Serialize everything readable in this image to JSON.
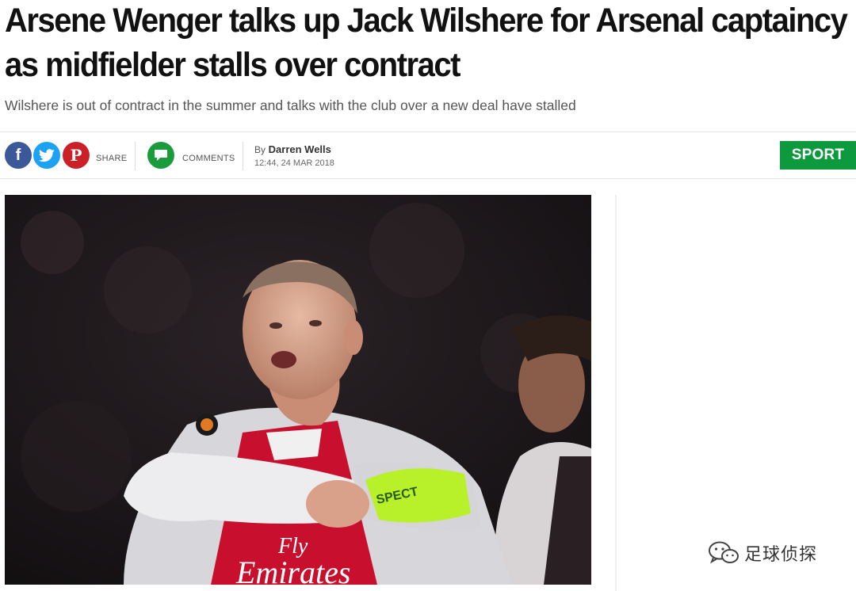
{
  "article": {
    "headline_line1": "Arsene Wenger talks up Jack Wilshere for Arsenal captaincy",
    "headline_line2": "as midfielder stalls over contract",
    "standfirst": "Wilshere is out of contract in the summer and talks with the club over a new deal have stalled",
    "author_prefix": "By",
    "author": "Darren Wells",
    "timestamp": "12:44, 24 MAR 2018",
    "section": "SPORT",
    "section_color": "#0d9a3f"
  },
  "share": {
    "facebook_glyph": "f",
    "pinterest_glyph": "P",
    "share_label": "SHARE",
    "comments_label": "COMMENTS",
    "facebook_color": "#3b5998",
    "twitter_color": "#1da1f2",
    "pinterest_color": "#cb2027",
    "comments_color": "#1b9c3c"
  },
  "photo": {
    "armband_text": "SPECT",
    "shirt_text_line1": "Fly",
    "shirt_text_line2": "Emirates"
  },
  "watermark": {
    "text": "足球侦探",
    "icon": "wechat-icon"
  }
}
